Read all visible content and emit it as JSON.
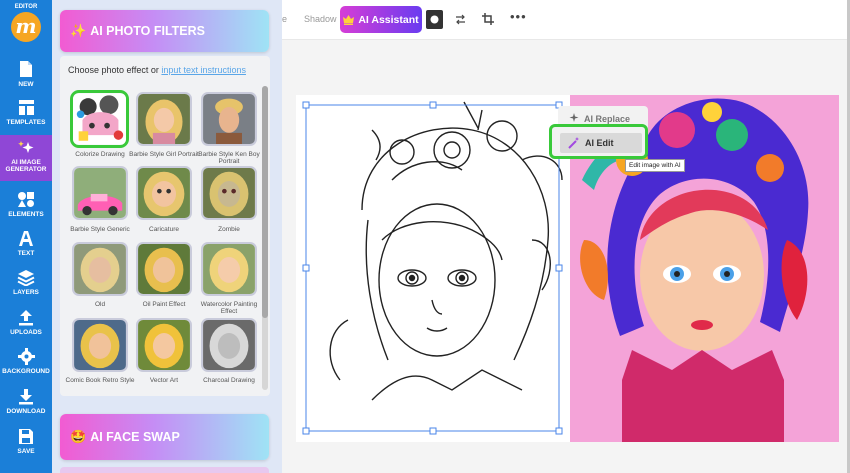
{
  "sidebar": {
    "editor_label": "EDITOR",
    "logo_letter": "m",
    "items": [
      {
        "label": "NEW",
        "icon": "file-icon"
      },
      {
        "label": "TEMPLATES",
        "icon": "templates-icon"
      },
      {
        "label": "AI IMAGE GENERATOR",
        "icon": "sparkle-icon"
      },
      {
        "label": "ELEMENTS",
        "icon": "elements-icon"
      },
      {
        "label": "TEXT",
        "icon": "text-icon"
      },
      {
        "label": "LAYERS",
        "icon": "layers-icon"
      },
      {
        "label": "UPLOADS",
        "icon": "upload-icon"
      },
      {
        "label": "BACKGROUND",
        "icon": "gear-icon"
      },
      {
        "label": "DOWNLOAD",
        "icon": "download-icon"
      },
      {
        "label": "SAVE",
        "icon": "save-icon"
      }
    ]
  },
  "panel": {
    "photo_filters": {
      "emoji": "✨",
      "title": "AI PHOTO FILTERS"
    },
    "subtitle": "Choose photo effect or",
    "subtitle_link": "input text instructions",
    "filters": [
      {
        "label": "Colorize Drawing"
      },
      {
        "label": "Barbie Style Girl Portrait"
      },
      {
        "label": "Barbie Style Ken Boy Portrait"
      },
      {
        "label": "Barbie Style Generic"
      },
      {
        "label": "Caricature"
      },
      {
        "label": "Zombie"
      },
      {
        "label": "Old"
      },
      {
        "label": "Oil Paint Effect"
      },
      {
        "label": "Watercolor Painting Effect"
      },
      {
        "label": "Comic Book Retro Style"
      },
      {
        "label": "Vector Art"
      },
      {
        "label": "Charcoal Drawing"
      }
    ],
    "face_swap": {
      "emoji": "🤩",
      "title": "AI FACE SWAP"
    }
  },
  "toolbar": {
    "partial": "e",
    "shadow": "Shadow",
    "ai_assistant": "AI Assistant",
    "ai_assistant_icon": "crown-icon"
  },
  "popup": {
    "ai_replace": "AI Replace",
    "ai_edit": "AI Edit",
    "tooltip": "Edit image with AI"
  },
  "colors": {
    "sidebar": "#1b7fd8",
    "sidebar_active": "#8f47d6",
    "highlight": "#39c93a",
    "ai_assistant_gradient_start": "#d63dd6",
    "ai_assistant_gradient_end": "#6a3cf0"
  }
}
